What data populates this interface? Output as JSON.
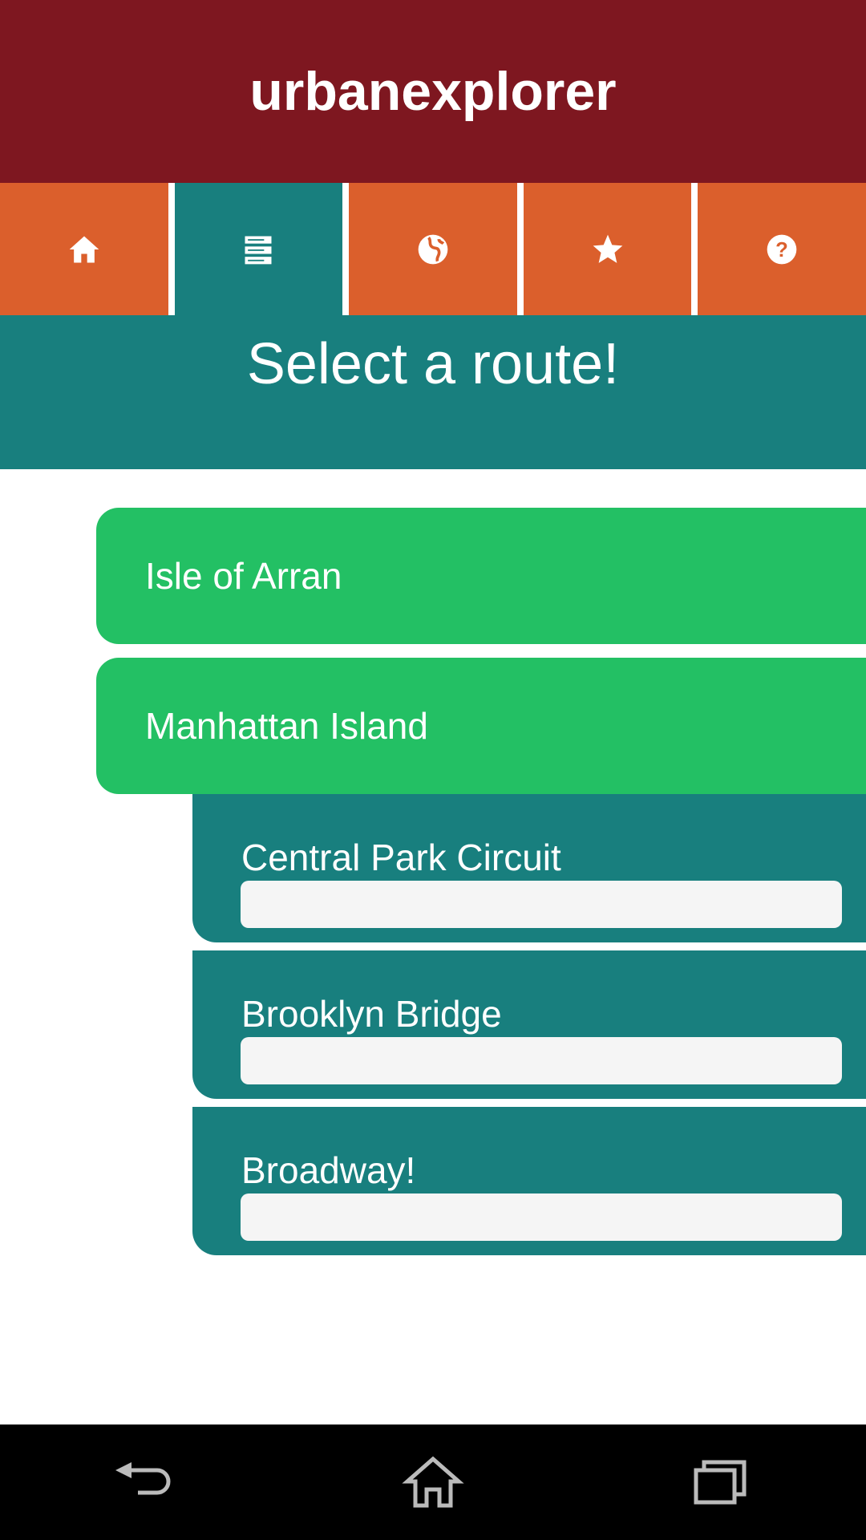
{
  "app": {
    "title": "urbanexplorer"
  },
  "nav": {
    "tabs": [
      {
        "icon": "home-icon",
        "active": false
      },
      {
        "icon": "list-icon",
        "active": true
      },
      {
        "icon": "globe-icon",
        "active": false
      },
      {
        "icon": "star-icon",
        "active": false
      },
      {
        "icon": "help-icon",
        "active": false
      }
    ]
  },
  "page": {
    "title": "Select a route!"
  },
  "routes": [
    {
      "label": "Isle of Arran"
    },
    {
      "label": "Manhattan Island",
      "subroutes": [
        {
          "label": "Central Park Circuit",
          "progress": 0
        },
        {
          "label": "Brooklyn Bridge",
          "progress": 0
        },
        {
          "label": "Broadway!",
          "progress": 0
        }
      ]
    }
  ],
  "colors": {
    "header": "#7e1720",
    "tab": "#db5f2c",
    "active": "#187f7e",
    "route": "#23c064"
  },
  "system_nav": [
    "back-icon",
    "home-icon",
    "recents-icon"
  ]
}
